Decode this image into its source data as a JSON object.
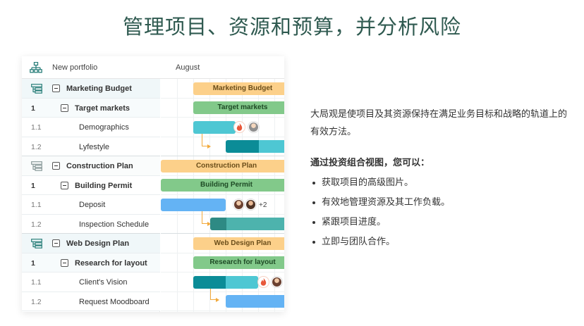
{
  "headline": "管理项目、资源和预算，并分析风险",
  "portfolio": {
    "header_label": "New portfolio",
    "timeline_month": "August",
    "rows": [
      {
        "num": "",
        "label": "Marketing Budget"
      },
      {
        "num": "1",
        "label": "Target markets"
      },
      {
        "num": "1.1",
        "label": "Demographics"
      },
      {
        "num": "1.2",
        "label": "Lyfestyle"
      },
      {
        "num": "",
        "label": "Construction Plan"
      },
      {
        "num": "1",
        "label": "Building Permit"
      },
      {
        "num": "1.1",
        "label": "Deposit"
      },
      {
        "num": "1.2",
        "label": "Inspection Schedule"
      },
      {
        "num": "",
        "label": "Web Design Plan"
      },
      {
        "num": "1",
        "label": "Research for layout"
      },
      {
        "num": "1.1",
        "label": "Client's Vision"
      },
      {
        "num": "1.2",
        "label": "Request Moodboard"
      }
    ],
    "bars": {
      "marketing_budget": "Marketing Budget",
      "target_markets": "Target markets",
      "construction_plan": "Construction Plan",
      "building_permit": "Building Permit",
      "web_design_plan": "Web Design Plan",
      "research_for_layout": "Research for layout"
    },
    "extra_assignees": "+2"
  },
  "info": {
    "intro": "大局观是使项目及其资源保持在满足业务目标和战略的轨道上的有效方法。",
    "subheading": "通过投资组合视图，您可以：",
    "bullets": [
      "获取项目的高级图片。",
      "有效地管理资源及其工作负载。",
      "紧跟项目进度。",
      "立即与团队合作。"
    ]
  },
  "colors": {
    "headline": "#2f5a50",
    "portfolio_bar": "#fcd08a",
    "project_bar": "#82c98a",
    "task_cyan": "#4ec7d3",
    "task_teal_dark": "#0b8c97",
    "task_blue": "#64b3f4",
    "dependency_line": "#f2a93b"
  }
}
